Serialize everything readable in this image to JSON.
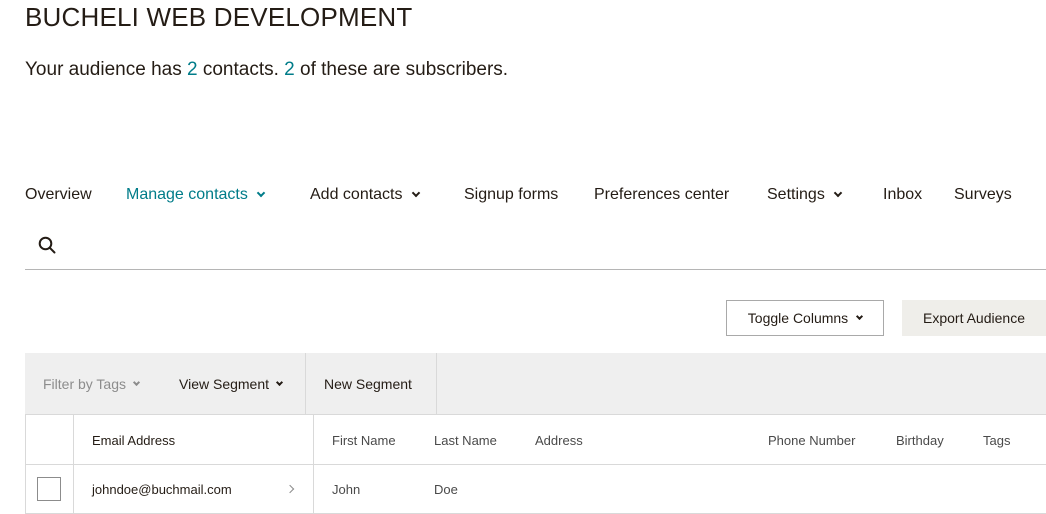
{
  "audience": {
    "name": "BUCHELI WEB DEVELOPMENT",
    "summary_prefix": "Your audience has ",
    "contacts_count": "2",
    "summary_middle": " contacts. ",
    "subscribers_count": "2",
    "summary_suffix": " of these are subscribers."
  },
  "nav": {
    "items": [
      {
        "label": "Overview"
      },
      {
        "label": "Manage contacts"
      },
      {
        "label": "Add contacts"
      },
      {
        "label": "Signup forms"
      },
      {
        "label": "Preferences center"
      },
      {
        "label": "Settings"
      },
      {
        "label": "Inbox"
      },
      {
        "label": "Surveys"
      }
    ],
    "active": "Manage contacts"
  },
  "toolbar": {
    "toggle_columns_label": "Toggle Columns",
    "export_label": "Export Audience"
  },
  "filters": {
    "filter_by_tags_label": "Filter by Tags",
    "view_segment_label": "View Segment",
    "new_segment_label": "New Segment"
  },
  "table": {
    "columns": [
      "Email Address",
      "First Name",
      "Last Name",
      "Address",
      "Phone Number",
      "Birthday",
      "Tags"
    ],
    "rows": [
      {
        "email": "johndoe@buchmail.com",
        "first_name": "John",
        "last_name": "Doe",
        "address": "",
        "phone": "",
        "birthday": "",
        "tags": ""
      }
    ]
  },
  "colors": {
    "accent": "#007c89",
    "text": "#241c15",
    "muted": "#8c8c8c",
    "filter_bar_bg": "#efefef",
    "export_button_bg": "#efeeea"
  }
}
